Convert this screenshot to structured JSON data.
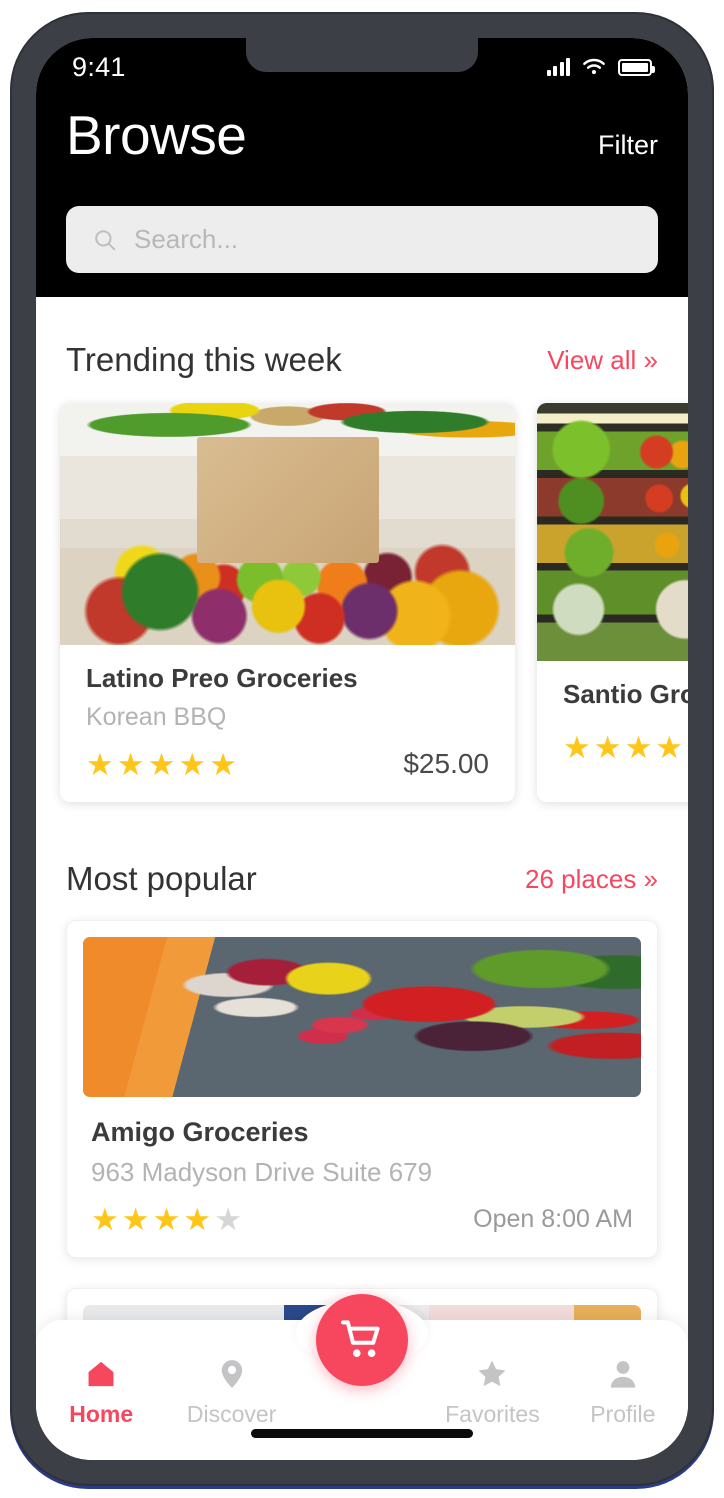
{
  "status_bar": {
    "time": "9:41",
    "signal_icon": "signal-bars-icon",
    "wifi_icon": "wifi-icon",
    "battery_icon": "battery-full-icon"
  },
  "header": {
    "title": "Browse",
    "filter_label": "Filter",
    "search": {
      "placeholder": "Search...",
      "value": "",
      "icon": "search-icon"
    },
    "background_color": "#000000"
  },
  "theme": {
    "accent": "#f7475f",
    "star_on": "#ffc61a",
    "star_off": "#d6d6d8",
    "text_primary": "#333333",
    "text_muted": "#b3b3b5"
  },
  "sections": [
    {
      "title": "Trending this week",
      "link_label": "View all »",
      "cards": [
        {
          "name": "Latino Preo Groceries",
          "subtitle": "Korean BBQ",
          "rating": 5,
          "rating_max": 5,
          "meta": "$25.00",
          "photo": "grocery-bag-with-fruits-and-vegetables"
        },
        {
          "name": "Santio Gro",
          "subtitle": "",
          "rating": 4,
          "rating_max": 5,
          "meta": "",
          "photo": "supermarket-produce-shelves"
        }
      ]
    },
    {
      "title": "Most popular",
      "link_label": "26 places »",
      "cards": [
        {
          "name": "Amigo Groceries",
          "subtitle": "963 Madyson Drive Suite 679",
          "rating": 4,
          "rating_max": 5,
          "meta": "Open 8:00 AM",
          "photo": "assorted-fresh-vegetables-on-slate"
        },
        {
          "name": "",
          "subtitle": "",
          "rating": 0,
          "rating_max": 5,
          "meta": "",
          "photo": "plated-dish-partial"
        }
      ]
    }
  ],
  "bottom_nav": {
    "items": [
      {
        "label": "Home",
        "icon": "home-icon",
        "active": true
      },
      {
        "label": "Discover",
        "icon": "map-pin-icon",
        "active": false
      },
      {
        "label": "Favorites",
        "icon": "star-icon",
        "active": false
      },
      {
        "label": "Profile",
        "icon": "person-icon",
        "active": false
      }
    ],
    "fab": {
      "icon": "shopping-cart-icon",
      "color": "#f7475f"
    }
  },
  "stars": {
    "filled": "★",
    "empty": "★"
  }
}
